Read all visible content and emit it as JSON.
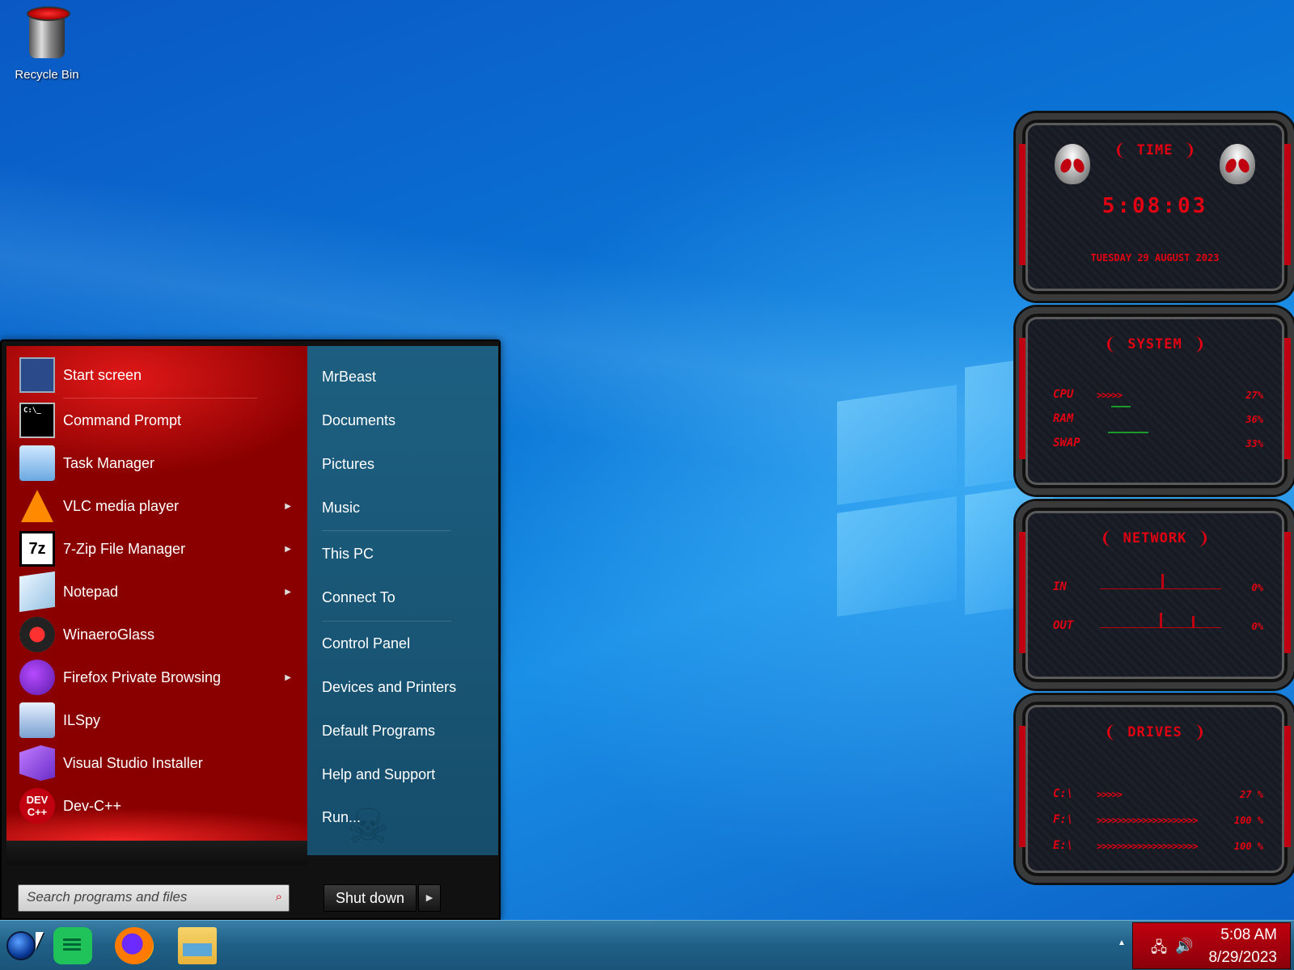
{
  "desktop": {
    "icons": [
      {
        "label": "Recycle Bin",
        "icon": "recycle-bin-icon"
      }
    ]
  },
  "start_menu": {
    "programs": [
      {
        "label": "Start screen",
        "icon": "start-screen-icon",
        "submenu": false
      },
      {
        "label": "Command Prompt",
        "icon": "command-prompt-icon",
        "submenu": false
      },
      {
        "label": "Task Manager",
        "icon": "task-manager-icon",
        "submenu": false
      },
      {
        "label": "VLC media player",
        "icon": "vlc-icon",
        "submenu": true
      },
      {
        "label": "7-Zip File Manager",
        "icon": "seven-zip-icon",
        "submenu": true
      },
      {
        "label": "Notepad",
        "icon": "notepad-icon",
        "submenu": true
      },
      {
        "label": "WinaeroGlass",
        "icon": "winaero-glass-icon",
        "submenu": false
      },
      {
        "label": "Firefox Private Browsing",
        "icon": "firefox-private-icon",
        "submenu": true
      },
      {
        "label": "ILSpy",
        "icon": "ilspy-icon",
        "submenu": false
      },
      {
        "label": "Visual Studio Installer",
        "icon": "visual-studio-installer-icon",
        "submenu": false
      },
      {
        "label": "Dev-C++",
        "icon": "dev-cpp-icon",
        "submenu": false
      }
    ],
    "icon_text": {
      "cmd": "C:\\_",
      "zip": "7z",
      "dev": "DEV\nC++"
    },
    "places": [
      "MrBeast",
      "Documents",
      "Pictures",
      "Music",
      "This PC",
      "Connect To",
      "Control Panel",
      "Devices and Printers",
      "Default Programs",
      "Help and Support",
      "Run..."
    ],
    "search_placeholder": "Search programs and files",
    "shutdown_label": "Shut down",
    "accent": "#c00010",
    "places_bg": "#1d5f80"
  },
  "gadgets": {
    "time": {
      "title": "TIME",
      "clock": "5:08:03",
      "date": "TUESDAY 29 AUGUST 2023"
    },
    "system": {
      "title": "SYSTEM",
      "rows": [
        {
          "label": "CPU",
          "bar": ">>>>>",
          "value": "27%"
        },
        {
          "label": "RAM",
          "bar": "",
          "value": "36%"
        },
        {
          "label": "SWAP",
          "bar": "",
          "value": "33%"
        }
      ]
    },
    "network": {
      "title": "NETWORK",
      "rows": [
        {
          "label": "IN",
          "value": "0%"
        },
        {
          "label": "OUT",
          "value": "0%"
        }
      ]
    },
    "drives": {
      "title": "DRIVES",
      "rows": [
        {
          "label": "C:\\",
          "bar": ">>>>>",
          "value": "27 %"
        },
        {
          "label": "F:\\",
          "bar": ">>>>>>>>>>>>>>>>>>>>",
          "value": "100 %"
        },
        {
          "label": "E:\\",
          "bar": ">>>>>>>>>>>>>>>>>>>>",
          "value": "100 %"
        }
      ]
    }
  },
  "taskbar": {
    "pinned": [
      {
        "name": "notes-app-icon"
      },
      {
        "name": "firefox-icon"
      },
      {
        "name": "file-explorer-icon"
      }
    ],
    "tray": {
      "time": "5:08 AM",
      "date": "8/29/2023"
    }
  }
}
